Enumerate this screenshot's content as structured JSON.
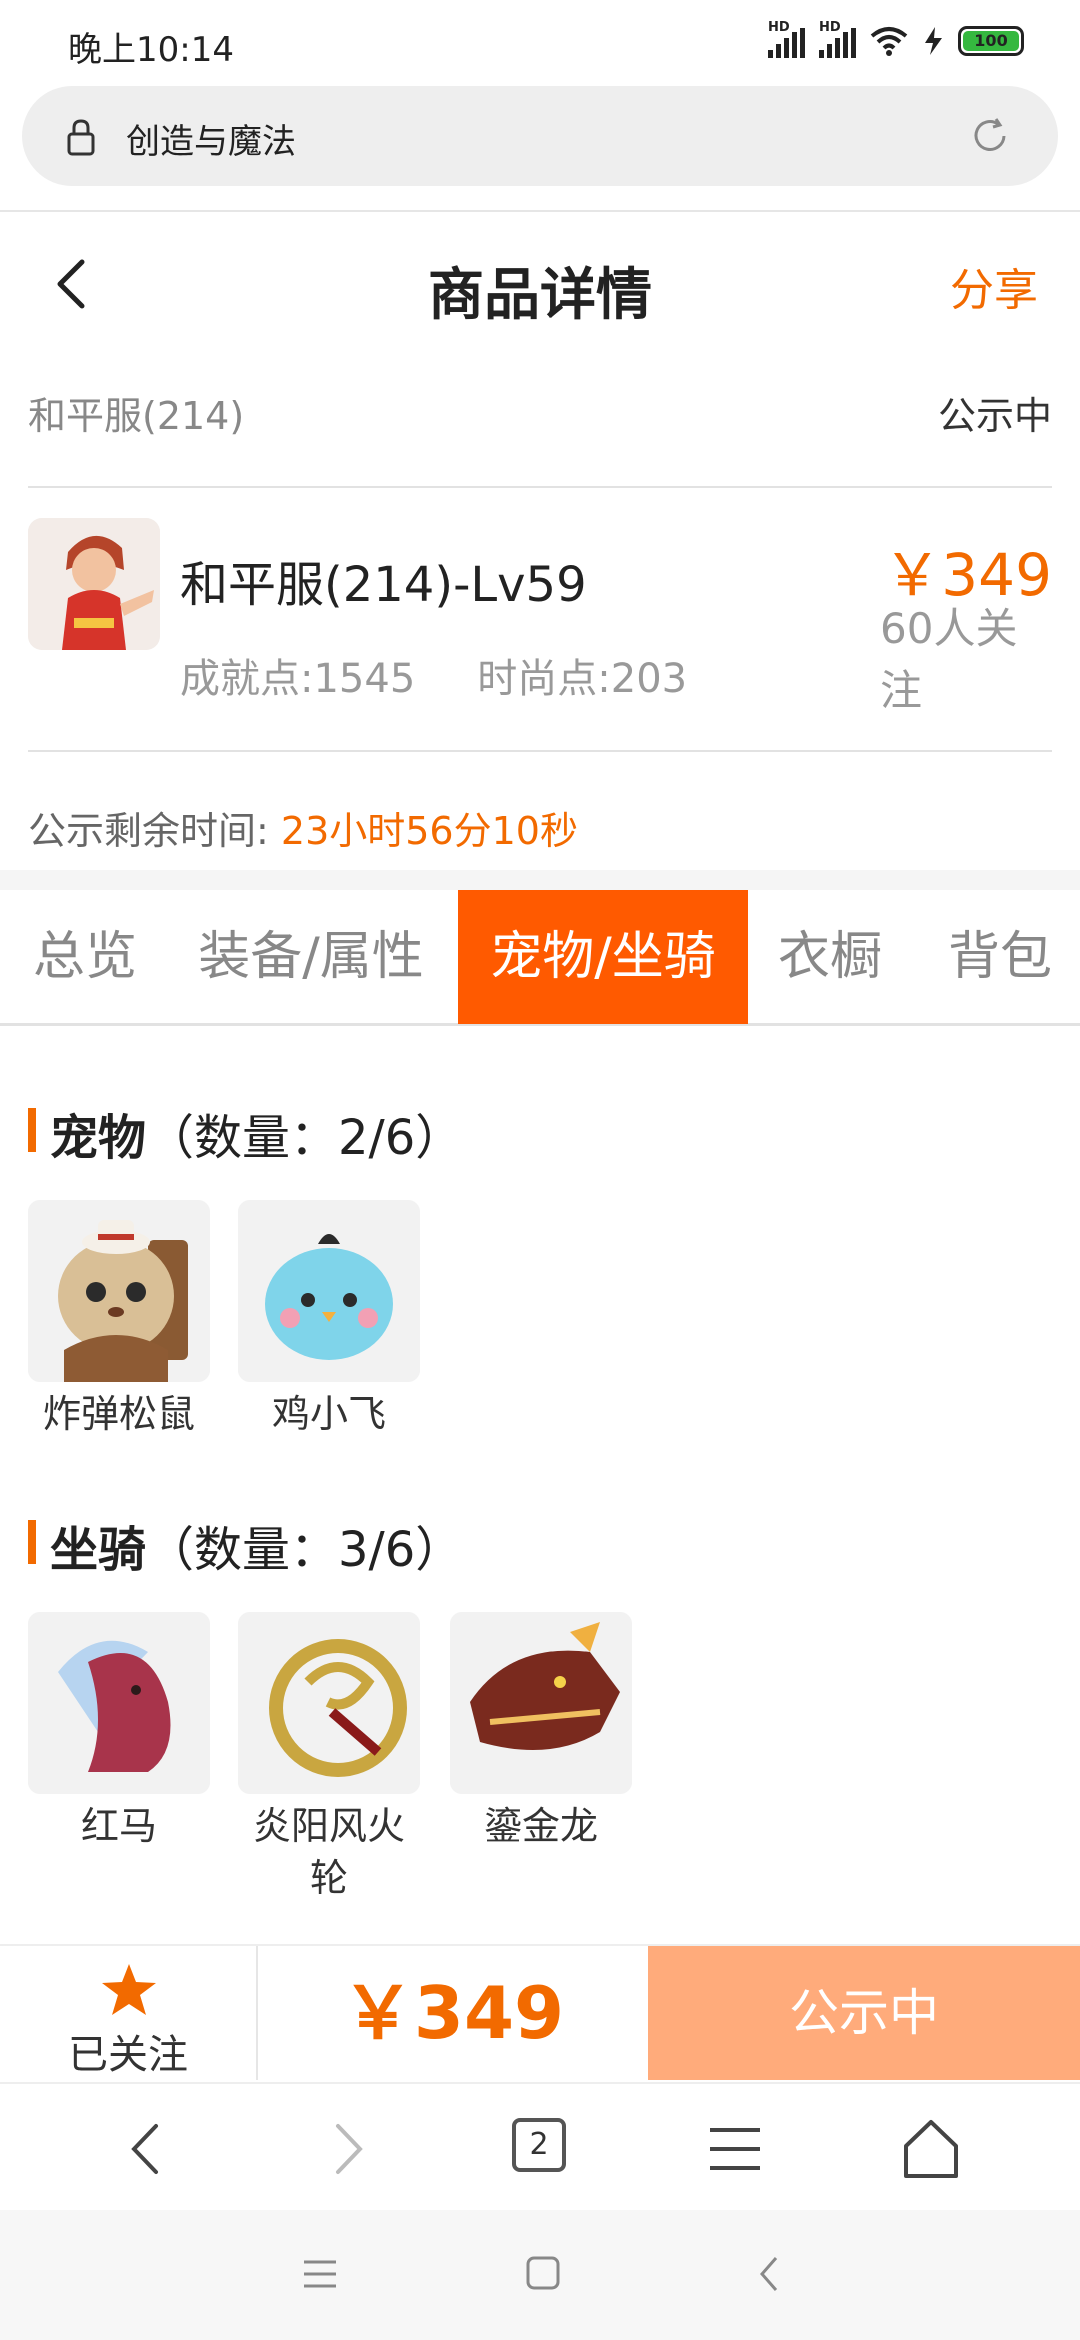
{
  "status_bar": {
    "time": "晚上10:14",
    "battery": "100",
    "hd1": "HD",
    "hd2": "HD"
  },
  "url_bar": {
    "url": "创造与魔法"
  },
  "header": {
    "title": "商品详情",
    "share": "分享"
  },
  "listing": {
    "server": "和平服(214)",
    "status": "公示中",
    "item_name": "和平服(214)-Lv59",
    "achievement": "成就点:1545",
    "fashion": "时尚点:203",
    "price": "￥349",
    "followers": "60人关注",
    "remaining_label": "公示剩余时间:",
    "remaining_value": "23小时56分10秒"
  },
  "tabs": [
    "总览",
    "装备/属性",
    "宠物/坐骑",
    "衣橱",
    "背包"
  ],
  "active_tab": 2,
  "pets": {
    "title": "宠物",
    "count": "（数量：2/6）",
    "items": [
      {
        "name": "炸弹松鼠"
      },
      {
        "name": "鸡小飞"
      }
    ]
  },
  "mounts": {
    "title": "坐骑",
    "count": "（数量：3/6）",
    "items": [
      {
        "name": "红马"
      },
      {
        "name": "炎阳风火轮"
      },
      {
        "name": "鎏金龙"
      }
    ]
  },
  "action_bar": {
    "follow_label": "已关注",
    "price": "￥349",
    "status": "公示中"
  },
  "browser_nav": {
    "tab_count": "2"
  },
  "colors": {
    "accent": "#f26a00",
    "tab_active": "#ff5a00",
    "status_button": "#ffab7b"
  }
}
